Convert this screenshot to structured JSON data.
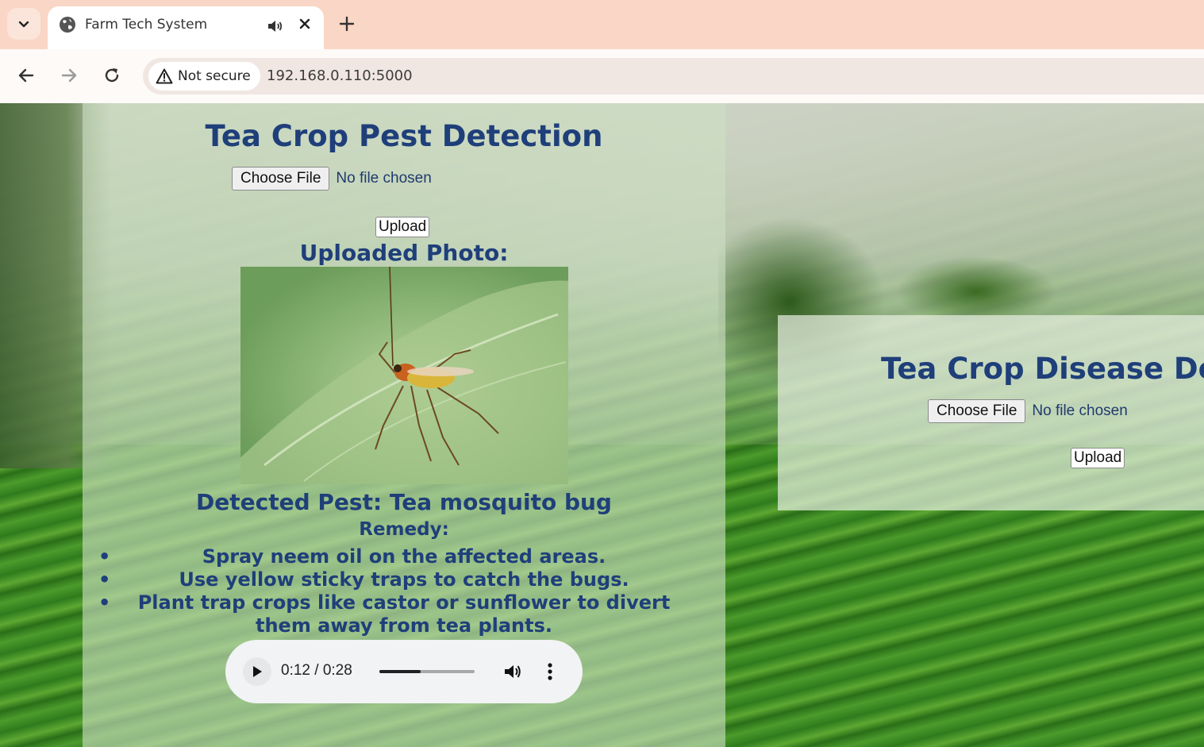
{
  "browser": {
    "tab_title": "Farm Tech System",
    "security_label": "Not secure",
    "url": "192.168.0.110:5000"
  },
  "pest_section": {
    "title": "Tea Crop Pest Detection",
    "choose_file_label": "Choose File",
    "file_status": "No file chosen",
    "upload_label": "Upload",
    "uploaded_heading": "Uploaded Photo:",
    "detected_text": "Detected Pest: Tea mosquito bug",
    "remedy_heading": "Remedy:",
    "remedies": [
      "Spray neem oil on the affected areas.",
      "Use yellow sticky traps to catch the bugs.",
      "Plant trap crops like castor or sunflower to divert them away from tea plants."
    ],
    "audio": {
      "time_label": "0:12 / 0:28",
      "progress_fraction": 0.43
    }
  },
  "disease_section": {
    "title": "Tea Crop Disease De",
    "choose_file_label": "Choose File",
    "file_status": "No file chosen",
    "upload_label": "Upload"
  },
  "icons": {
    "tab_menu": "chevron-down-icon",
    "tab_favicon": "globe-icon",
    "tab_audio": "speaker-icon",
    "tab_close": "close-icon",
    "new_tab": "plus-icon",
    "back": "arrow-left-icon",
    "forward": "arrow-right-icon",
    "reload": "reload-icon",
    "security": "warning-triangle-icon",
    "audio_play": "play-icon",
    "audio_volume": "volume-icon",
    "audio_more": "more-vertical-icon"
  },
  "colors": {
    "tab_strip": "#f9d6c5",
    "heading_text": "#1f3f7a"
  }
}
